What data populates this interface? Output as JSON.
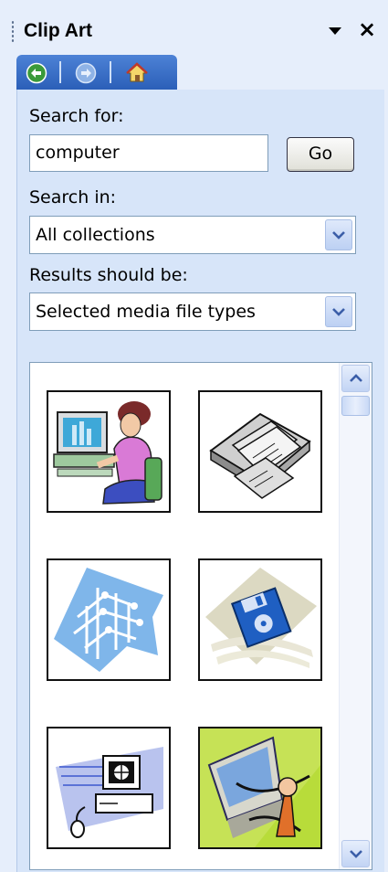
{
  "pane": {
    "title": "Clip Art",
    "menu_icon": "dropdown-arrow-icon",
    "close_label": "×"
  },
  "nav": {
    "back_icon": "back-arrow-icon",
    "forward_icon": "forward-arrow-icon",
    "home_icon": "home-icon"
  },
  "search": {
    "label": "Search for:",
    "value": "computer",
    "go_label": "Go"
  },
  "search_in": {
    "label": "Search in:",
    "value": "All collections"
  },
  "results_type": {
    "label": "Results should be:",
    "value": "Selected media file types"
  },
  "results": {
    "items": [
      {
        "icon": "woman-at-computer-icon"
      },
      {
        "icon": "floppy-disks-tray-icon"
      },
      {
        "icon": "circuit-board-icon"
      },
      {
        "icon": "blue-floppy-disk-icon"
      },
      {
        "icon": "desktop-computer-mouse-icon"
      },
      {
        "icon": "abstract-computer-art-icon"
      }
    ]
  },
  "colors": {
    "nav_bar": "#2b5fb8",
    "pane_bg": "#e6eefb",
    "field_border": "#7f9db9"
  }
}
